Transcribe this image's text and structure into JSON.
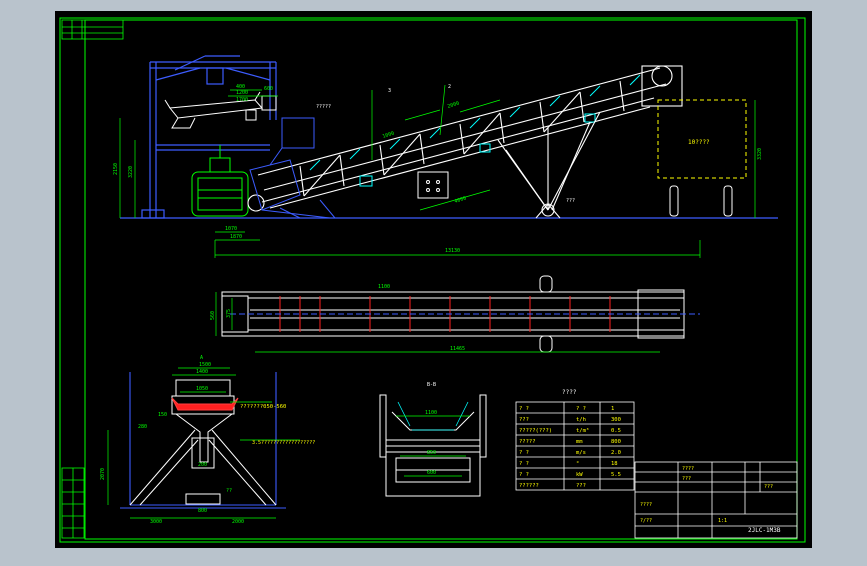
{
  "colors": {
    "outer_bg": "#b9c3cc",
    "sheet": "#000000",
    "frame": "#00ff00",
    "structure": "#ffffff",
    "blue": "#3c5cff",
    "cyan": "#00ffff",
    "yellow": "#ffff00",
    "magenta": "#ff33ff",
    "red": "#ff2020",
    "green_dim": "#11cc11"
  },
  "side_view": {
    "dims": {
      "d_1200": "1200",
      "d_400": "400",
      "d_1700": "1700",
      "d_2150": "2150",
      "d_3220": "3220",
      "d_600": "600",
      "d_1070": "1070",
      "d_1870": "1870",
      "d_13130": "13130",
      "d_3320": "3320",
      "d_2000": "2000",
      "d_4000": "4000",
      "d_1000": "1000"
    },
    "labels": {
      "hopper_note": "?????",
      "box_note": "10????",
      "pivot_note": "???",
      "callout_2": "2",
      "callout_3": "3"
    }
  },
  "plan_view": {
    "dims": {
      "d_width": "1100",
      "d_total": "11465",
      "d_h1": "560",
      "d_h2": "375"
    }
  },
  "section_a": {
    "dims": {
      "d_1500": "1500",
      "d_1400": "1400",
      "d_1050": "1050",
      "d_150": "150",
      "d_3000_left": "3000",
      "d_2000_right": "2000",
      "d_2070": "2070",
      "d_200": "200",
      "d_800": "800",
      "d_280": "280"
    },
    "labels": {
      "note_1": "???????050-560",
      "note_2": "3.5??????????????????",
      "title": "A",
      "d_angle": "??"
    }
  },
  "section_b": {
    "title": "B-B",
    "dims": {
      "d_1": "1100",
      "d_2": "850",
      "d_3": "600"
    }
  },
  "spec_table": {
    "title": "????",
    "rows": [
      [
        "?  ?",
        "?  ?",
        "1"
      ],
      [
        "???",
        "t/h",
        "300"
      ],
      [
        "?????(???)",
        "t/m³",
        "0.5"
      ],
      [
        "?????",
        "mm",
        "800"
      ],
      [
        "?  ?",
        "m/s",
        "2.0"
      ],
      [
        "?  ?",
        "°",
        "18"
      ],
      [
        "?  ?",
        "kW",
        "5.5"
      ],
      [
        "??????",
        "???",
        ""
      ]
    ]
  },
  "title_block": {
    "drawing_no": "2JLC-1M3B",
    "cells": [
      "????",
      "????",
      "???",
      "1:1",
      "?/??",
      "???"
    ]
  }
}
